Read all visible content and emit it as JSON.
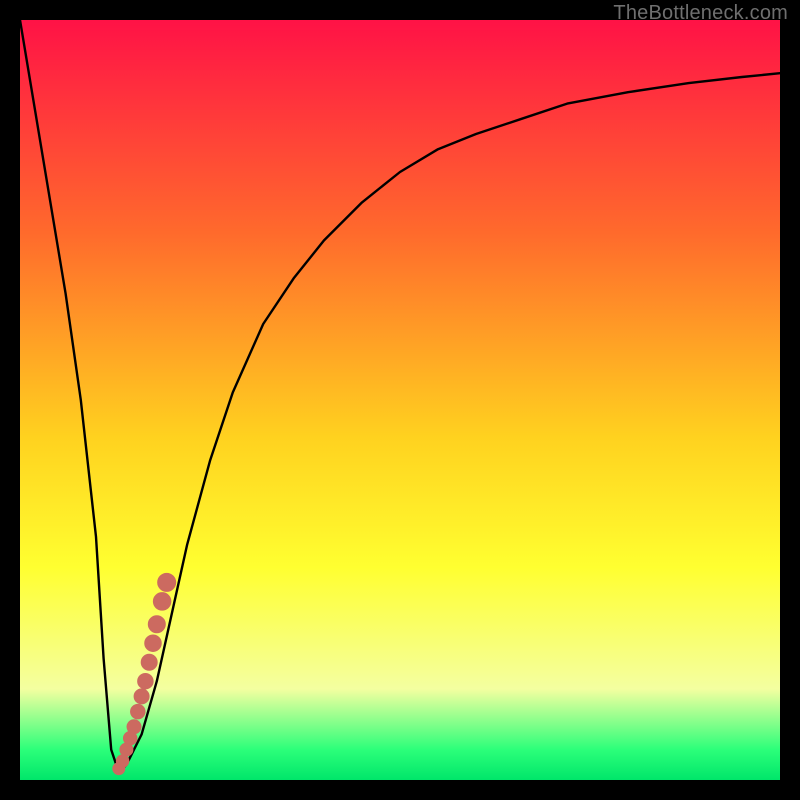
{
  "watermark": "TheBottleneck.com",
  "colors": {
    "frame": "#000000",
    "curve": "#000000",
    "marker_fill": "#cc6a60",
    "marker_stroke": "#cc6a60",
    "gradient_top": "#ff1246",
    "gradient_mid1": "#ff6a2c",
    "gradient_mid2": "#ffd21f",
    "gradient_mid3": "#ffff30",
    "gradient_mid4": "#f4ffa0",
    "gradient_green": "#2cff7a",
    "gradient_bottom": "#00e66a"
  },
  "chart_data": {
    "type": "line",
    "title": "",
    "xlabel": "",
    "ylabel": "",
    "xlim": [
      0,
      100
    ],
    "ylim": [
      0,
      100
    ],
    "series": [
      {
        "name": "bottleneck-curve",
        "x": [
          0,
          2,
          4,
          6,
          8,
          10,
          11,
          12,
          13,
          14,
          16,
          18,
          20,
          22,
          25,
          28,
          32,
          36,
          40,
          45,
          50,
          55,
          60,
          66,
          72,
          80,
          88,
          95,
          100
        ],
        "y": [
          100,
          88,
          76,
          64,
          50,
          32,
          16,
          4,
          1,
          2,
          6,
          13,
          22,
          31,
          42,
          51,
          60,
          66,
          71,
          76,
          80,
          83,
          85,
          87,
          89,
          90.5,
          91.7,
          92.5,
          93
        ]
      }
    ],
    "markers": {
      "name": "highlighted-points",
      "x": [
        13.0,
        13.5,
        14.0,
        14.5,
        15.0,
        15.5,
        16.0,
        16.5,
        17.0,
        17.5,
        18.0,
        18.7,
        19.3
      ],
      "y": [
        1.5,
        2.5,
        4.0,
        5.5,
        7.0,
        9.0,
        11.0,
        13.0,
        15.5,
        18.0,
        20.5,
        23.5,
        26.0
      ]
    },
    "marker_radius_top": 9,
    "marker_radius_bottom": 6
  }
}
